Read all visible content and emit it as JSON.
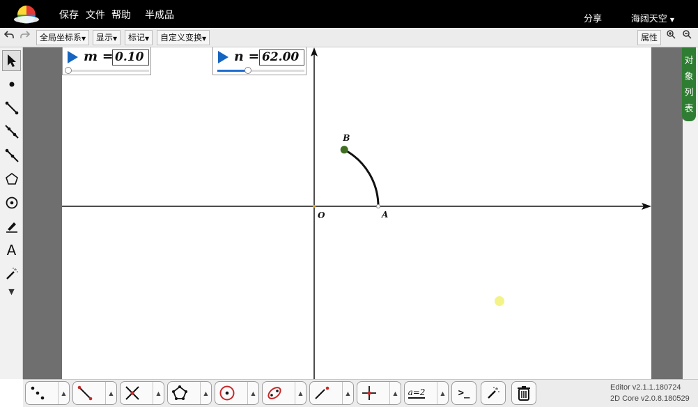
{
  "menu": {
    "save": "保存",
    "file": "文件",
    "help": "帮助",
    "semi_finished": "半成品",
    "share": "分享",
    "user": "海阔天空"
  },
  "toolbar": {
    "undo_icon": "undo-icon",
    "redo_icon": "redo-icon",
    "coord_system": "全局坐标系",
    "display": "显示",
    "marks": "标记",
    "custom_transform": "自定义变换",
    "properties": "属性"
  },
  "object_list": [
    "对",
    "象",
    "列",
    "表"
  ],
  "sliders": [
    {
      "name": "m",
      "value": "0.10",
      "fraction": 0.0
    },
    {
      "name": "n",
      "value": "62.00",
      "fraction": 0.35
    }
  ],
  "geometry": {
    "origin_label": "O",
    "point_a_label": "A",
    "point_b_label": "B",
    "arc_angle_deg": 62.0
  },
  "bottom_tools": [
    "point-tools",
    "segment-tools",
    "intersection-tools",
    "polygon-tools",
    "circle-tools",
    "conic-tools",
    "line-tools",
    "coordinate-tools",
    "text-tools",
    "command-tools",
    "magic-tools",
    "delete-tools"
  ],
  "bottom_text_tool": "a=2",
  "bottom_command_tool": ">_",
  "version": {
    "editor": "Editor v2.1.1.180724",
    "core": "2D Core v2.0.8.180529"
  },
  "colors": {
    "accent": "#1565c0",
    "object_list": "#2f7d32",
    "point_b": "#3f6e22",
    "highlight": "#f2f27a"
  }
}
